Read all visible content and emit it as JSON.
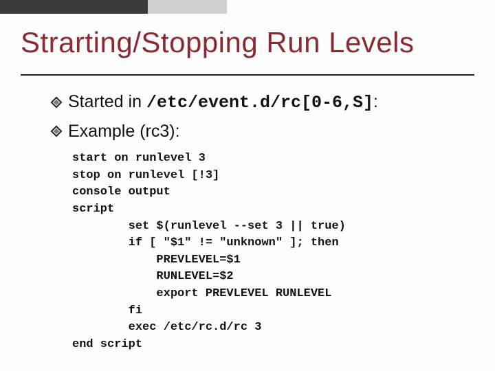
{
  "title": "Strarting/Stopping Run Levels",
  "bullets": [
    {
      "prefix": "Started in ",
      "mono": "/etc/event.d/rc[0-6,S]",
      "suffix": ":"
    },
    {
      "prefix": "Example (rc3):",
      "mono": "",
      "suffix": ""
    }
  ],
  "code": "start on runlevel 3\nstop on runlevel [!3]\nconsole output\nscript\n        set $(runlevel --set 3 || true)\n        if [ \"$1\" != \"unknown\" ]; then\n            PREVLEVEL=$1\n            RUNLEVEL=$2\n            export PREVLEVEL RUNLEVEL\n        fi\n        exec /etc/rc.d/rc 3\nend script"
}
